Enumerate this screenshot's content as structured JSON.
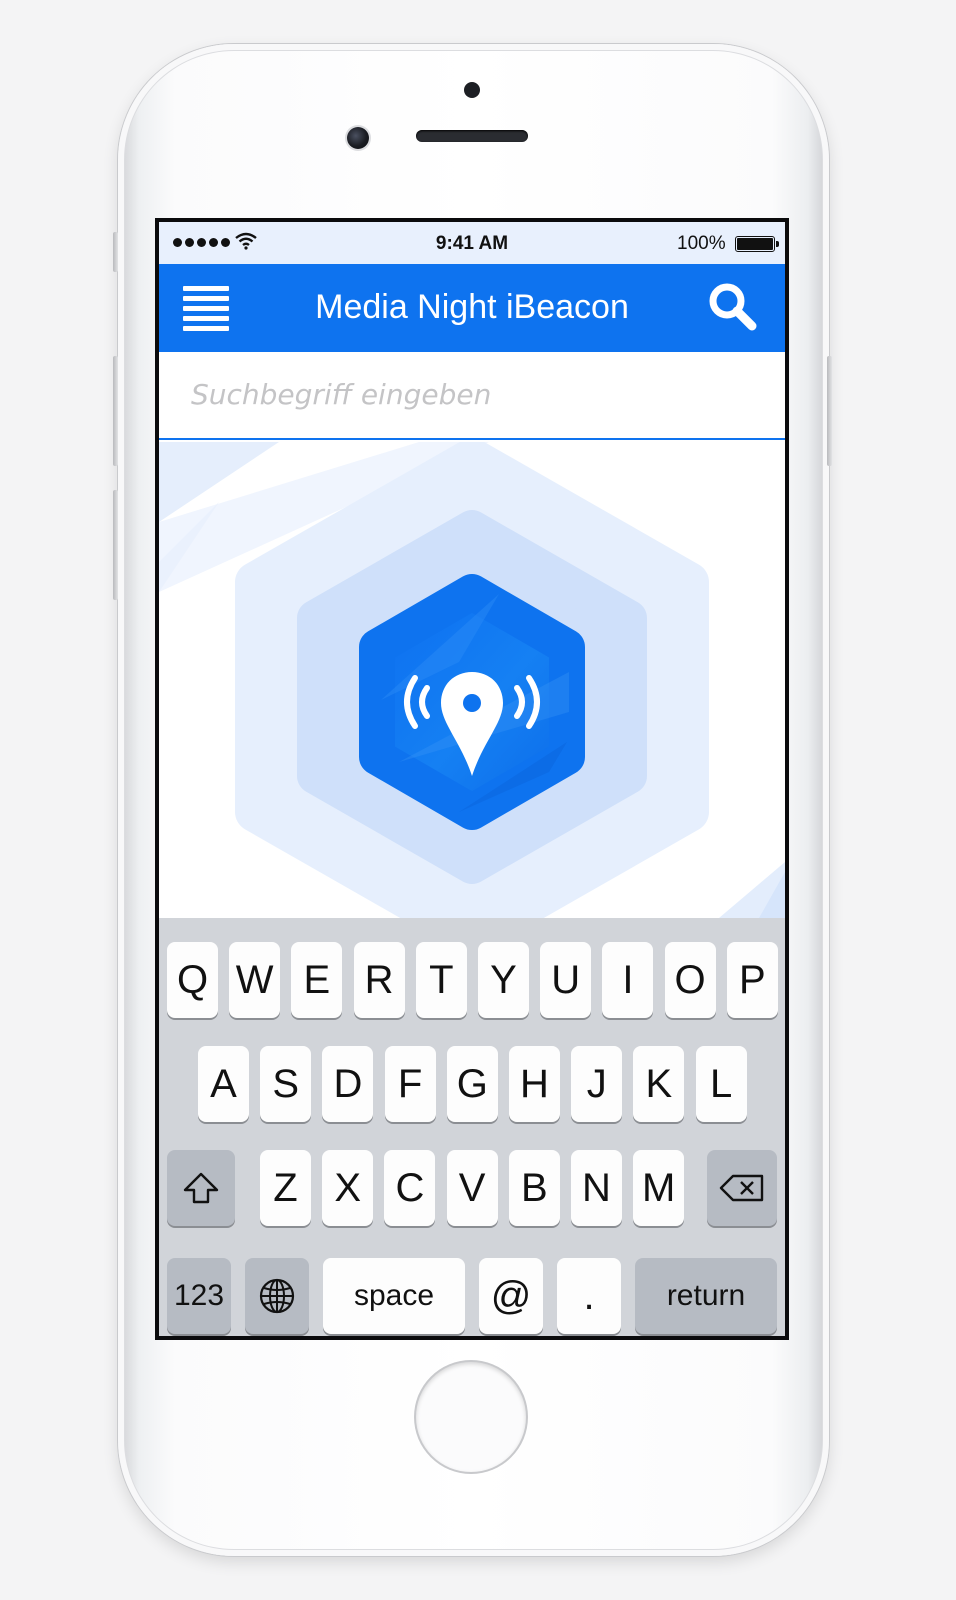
{
  "status_bar": {
    "time": "9:41 AM",
    "battery_percent": "100%",
    "signal_bars": 5,
    "wifi_icon": "wifi-icon",
    "battery_icon": "battery-icon"
  },
  "navbar": {
    "title": "Media Night iBeacon",
    "menu_icon": "hamburger-menu-icon",
    "search_icon": "search-icon",
    "background_color": "#0e73ef"
  },
  "search": {
    "placeholder": "Suchbegriff eingeben",
    "value": ""
  },
  "hero": {
    "icon": "ibeacon-location-pin-icon",
    "accent_color": "#0e73ef"
  },
  "keyboard": {
    "row1": [
      "Q",
      "W",
      "E",
      "R",
      "T",
      "Y",
      "U",
      "I",
      "O",
      "P"
    ],
    "row2": [
      "A",
      "S",
      "D",
      "F",
      "G",
      "H",
      "J",
      "K",
      "L"
    ],
    "row3": [
      "Z",
      "X",
      "C",
      "V",
      "B",
      "N",
      "M"
    ],
    "shift_icon": "shift-icon",
    "delete_icon": "backspace-icon",
    "numbers_label": "123",
    "globe_icon": "globe-icon",
    "space_label": "space",
    "at_label": "@",
    "period_label": ".",
    "return_label": "return"
  }
}
